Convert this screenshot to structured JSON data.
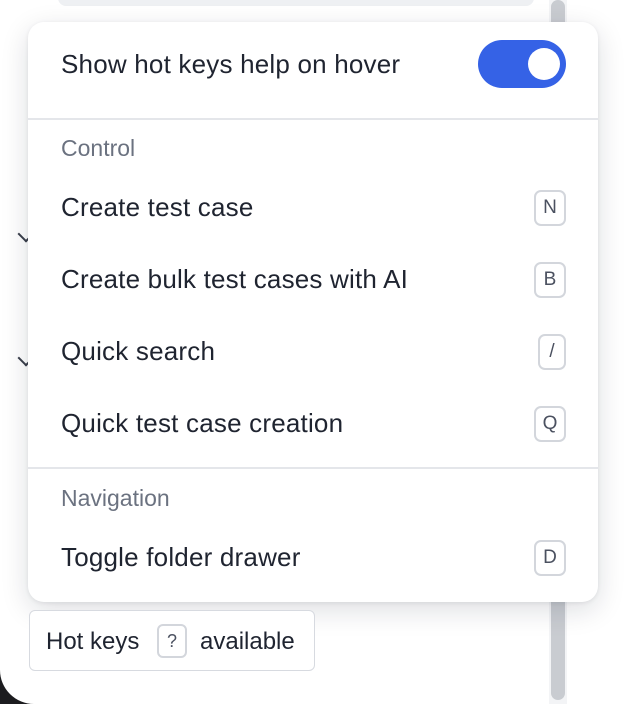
{
  "hotkeys_popover": {
    "toggle": {
      "label": "Show hot keys help on hover",
      "enabled": true,
      "accent_color": "#3562e6"
    },
    "sections": [
      {
        "heading": "Control",
        "items": [
          {
            "label": "Create test case",
            "key": "N"
          },
          {
            "label": "Create bulk test cases with AI",
            "key": "B"
          },
          {
            "label": "Quick search",
            "key": "/"
          },
          {
            "label": "Quick test case creation",
            "key": "Q"
          }
        ]
      },
      {
        "heading": "Navigation",
        "items": [
          {
            "label": "Toggle folder drawer",
            "key": "D"
          }
        ]
      }
    ]
  },
  "hotkeys_chip": {
    "prefix": "Hot keys",
    "key": "?",
    "suffix": "available"
  }
}
